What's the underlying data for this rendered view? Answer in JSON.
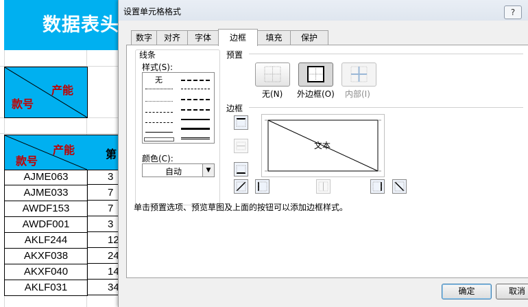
{
  "sheet": {
    "title": "数据表头",
    "header_top": "产能",
    "header_bottom": "款号",
    "col_b_header": "第",
    "rows": [
      {
        "code": "AJME063",
        "value": "3"
      },
      {
        "code": "AJME033",
        "value": "7"
      },
      {
        "code": "AWDF153",
        "value": "7"
      },
      {
        "code": "AWDF001",
        "value": "3"
      },
      {
        "code": "AKLF244",
        "value": "12"
      },
      {
        "code": "AKXF038",
        "value": "24"
      },
      {
        "code": "AKXF040",
        "value": "14"
      },
      {
        "code": "AKLF031",
        "value": "34"
      }
    ],
    "accent_color": "#00b0f0",
    "header_text_color": "#c00000"
  },
  "dialog": {
    "title": "设置单元格格式",
    "help_label": "?",
    "tabs": [
      "数字",
      "对齐",
      "字体",
      "边框",
      "填充",
      "保护"
    ],
    "active_tab": "边框",
    "line_group": {
      "label": "线条",
      "style_label": "样式(S):",
      "none_style": "无",
      "color_label": "颜色(C):",
      "color_value": "自动"
    },
    "presets": {
      "label": "预置",
      "none": "无(N)",
      "outline": "外边框(O)",
      "inside": "内部(I)"
    },
    "border": {
      "label": "边框",
      "preview_text": "文本"
    },
    "hint": "单击预置选项、预览草图及上面的按钮可以添加边框样式。",
    "ok_label": "确定",
    "cancel_label": "取消"
  }
}
